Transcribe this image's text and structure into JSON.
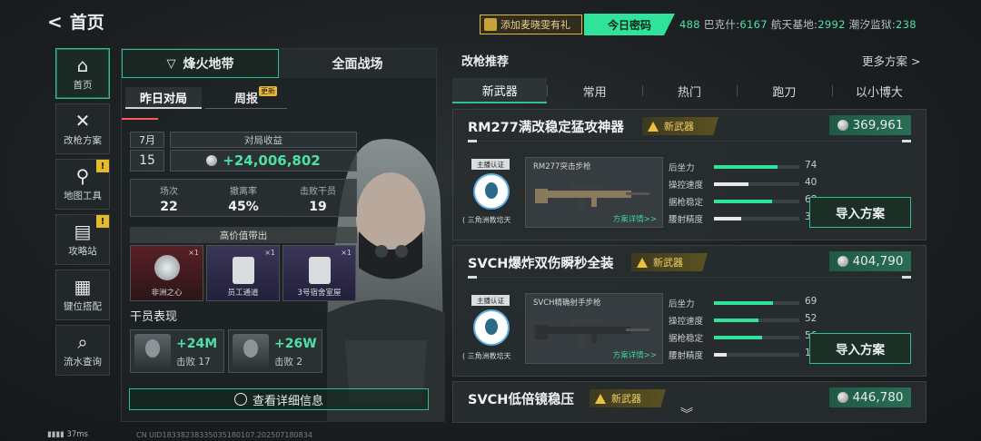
{
  "header": {
    "back_label": "首页",
    "promo_text": "添加麦晓雯有礼",
    "password_label": "今日密码",
    "codes": [
      {
        "name": "",
        "num": "488"
      },
      {
        "name": "巴克什:",
        "num": "6167"
      },
      {
        "name": "航天基地:",
        "num": "2992"
      },
      {
        "name": "潮汐监狱:",
        "num": "238"
      }
    ]
  },
  "nav": [
    {
      "label": "首页",
      "icon": "home-icon",
      "active": true,
      "alert": false
    },
    {
      "label": "改枪方案",
      "icon": "wrench-icon",
      "active": false,
      "alert": false
    },
    {
      "label": "地图工具",
      "icon": "map-pin-icon",
      "active": false,
      "alert": true
    },
    {
      "label": "攻略站",
      "icon": "book-icon",
      "active": false,
      "alert": true
    },
    {
      "label": "键位搭配",
      "icon": "keyboard-icon",
      "active": false,
      "alert": false
    },
    {
      "label": "流水查询",
      "icon": "search-doc-icon",
      "active": false,
      "alert": false
    }
  ],
  "alert_symbol": "!",
  "center": {
    "tab_a": "烽火地带",
    "tab_b": "全面战场",
    "sub_tab_1": "昨日对局",
    "sub_tab_2": "周报",
    "new_tag": "更新",
    "month": "7月",
    "day": "15",
    "earnings_label": "对局收益",
    "earnings_value": "+24,006,802",
    "stats": [
      {
        "label": "场次",
        "value": "22"
      },
      {
        "label": "撤离率",
        "value": "45%"
      },
      {
        "label": "击败干员",
        "value": "19"
      }
    ],
    "high_value_label": "高价值带出",
    "items": [
      {
        "name": "非洲之心",
        "count": "×1"
      },
      {
        "name": "员工通道",
        "count": "×1"
      },
      {
        "name": "3号宿舍室屋",
        "count": "×1"
      }
    ],
    "performance_label": "干员表现",
    "operators": [
      {
        "value": "+24M",
        "kills": "击败 17"
      },
      {
        "value": "+26W",
        "kills": "击败 2"
      }
    ],
    "detail_button": "查看详细信息"
  },
  "right": {
    "title": "改枪推荐",
    "more": "更多方案 >",
    "tabs": [
      "新武器",
      "常用",
      "热门",
      "跑刀",
      "以小博大"
    ],
    "cards": [
      {
        "name": "RM277满改稳定猛攻神器",
        "badge": "新武器",
        "price": "369,961",
        "anchor_tag": "主播认证",
        "anchor_caption": "( 三角洲教培天",
        "gun_name": "RM277突击步枪",
        "detail": "方案详情>>",
        "stats": [
          {
            "label": "后坐力",
            "value": 74,
            "color": "#2fe39a"
          },
          {
            "label": "操控速度",
            "value": 40,
            "color": "#e6eaeb"
          },
          {
            "label": "据枪稳定",
            "value": 68,
            "color": "#2fe39a"
          },
          {
            "label": "腰射精度",
            "value": 32,
            "color": "#e6eaeb"
          }
        ],
        "button": "导入方案"
      },
      {
        "name": "SVCH爆炸双伤瞬秒全装",
        "badge": "新武器",
        "price": "404,790",
        "anchor_tag": "主播认证",
        "anchor_caption": "( 三角洲教培天",
        "gun_name": "SVCH精确射手步枪",
        "detail": "方案详情>>",
        "stats": [
          {
            "label": "后坐力",
            "value": 69,
            "color": "#2fe39a"
          },
          {
            "label": "操控速度",
            "value": 52,
            "color": "#2fe39a"
          },
          {
            "label": "据枪稳定",
            "value": 56,
            "color": "#2fe39a"
          },
          {
            "label": "腰射精度",
            "value": 15,
            "color": "#e6eaeb"
          }
        ],
        "button": "导入方案"
      },
      {
        "name": "SVCH低倍镜稳压",
        "badge": "新武器",
        "price": "446,780"
      }
    ]
  },
  "footer": {
    "fps": "37ms",
    "uid": "CN UID183382383350351801​07.202507180834"
  }
}
